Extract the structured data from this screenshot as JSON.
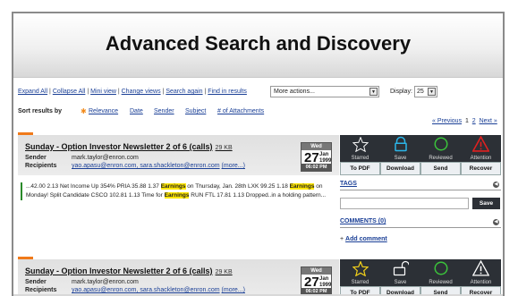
{
  "page_title": "Advanced Search and Discovery",
  "toolbar": {
    "links": [
      "Expand All",
      "Collapse All",
      "Mini view",
      "Change views",
      "Search again",
      "Find in results"
    ],
    "actions_value": "More actions...",
    "display_label": "Display:",
    "display_value": "25"
  },
  "sort": {
    "label": "Sort results by",
    "options": [
      "Relevance",
      "Date",
      "Sender",
      "Subject",
      "# of Attachments"
    ]
  },
  "pager": {
    "prev": "« Previous",
    "page1": "1",
    "page2": "2",
    "next": "Next »"
  },
  "results": [
    {
      "title": "Sunday - Option Investor Newsletter 2 of 6 (calls)",
      "size": "29 KB",
      "sender_label": "Sender",
      "sender": "mark.taylor@enron.com",
      "recipients_label": "Recipients",
      "recipients": "yao.apasu@enron.com, sara.shackleton@enron.com",
      "more": "(more...)",
      "date": {
        "dow": "Wed",
        "day": "27",
        "month": "Jan",
        "year": "1999",
        "time": "06:02 PM"
      },
      "snippet": {
        "p1": "...42.00 2.13 Net Income Up 354% PRIA 35.88 1.37 ",
        "h1": "Earnings",
        "p2": " on Thursday, Jan. 28th LXK 99.25 1.18 ",
        "h2": "Earnings",
        "p3": " on Monday! Split Candidate CSCO 102.81 1.13 Time for ",
        "h3": "Earnings",
        "p4": " RUN FTL 17.81 1.13 Dropped..in a holding pattern..."
      }
    },
    {
      "title": "Sunday - Option Investor Newsletter 2 of 6 (calls)",
      "size": "29 KB",
      "sender_label": "Sender",
      "sender": "mark.taylor@enron.com",
      "recipients_label": "Recipients",
      "recipients": "yao.apasu@enron.com, sara.shackleton@enron.com",
      "more": "(more...)",
      "date": {
        "dow": "Wed",
        "day": "27",
        "month": "Jan",
        "year": "1999",
        "time": "06:02 PM"
      }
    }
  ],
  "actions": {
    "icons": [
      {
        "label": "Starred",
        "icon": "star-icon",
        "color": "#ffffff"
      },
      {
        "label": "Save",
        "icon": "lock-icon",
        "color": "#2bb5e8"
      },
      {
        "label": "Reviewed",
        "icon": "circle-icon",
        "color": "#3bc23b"
      },
      {
        "label": "Attention",
        "icon": "warning-icon",
        "color": "#e02020"
      }
    ],
    "buttons": [
      "To PDF",
      "Download",
      "Send",
      "Recover"
    ]
  },
  "actions2_icons": [
    {
      "label": "Starred",
      "icon": "star-icon",
      "color": "#f5d21a"
    },
    {
      "label": "Save",
      "icon": "unlock-icon",
      "color": "#ffffff"
    },
    {
      "label": "Reviewed",
      "icon": "circle-icon",
      "color": "#3bc23b"
    },
    {
      "label": "Attention",
      "icon": "warning-icon",
      "color": "#ffffff"
    }
  ],
  "side": {
    "tags_label": "TAGS",
    "save_label": "Save",
    "comments_label": "COMMENTS (0)",
    "add_comment": "Add comment"
  }
}
